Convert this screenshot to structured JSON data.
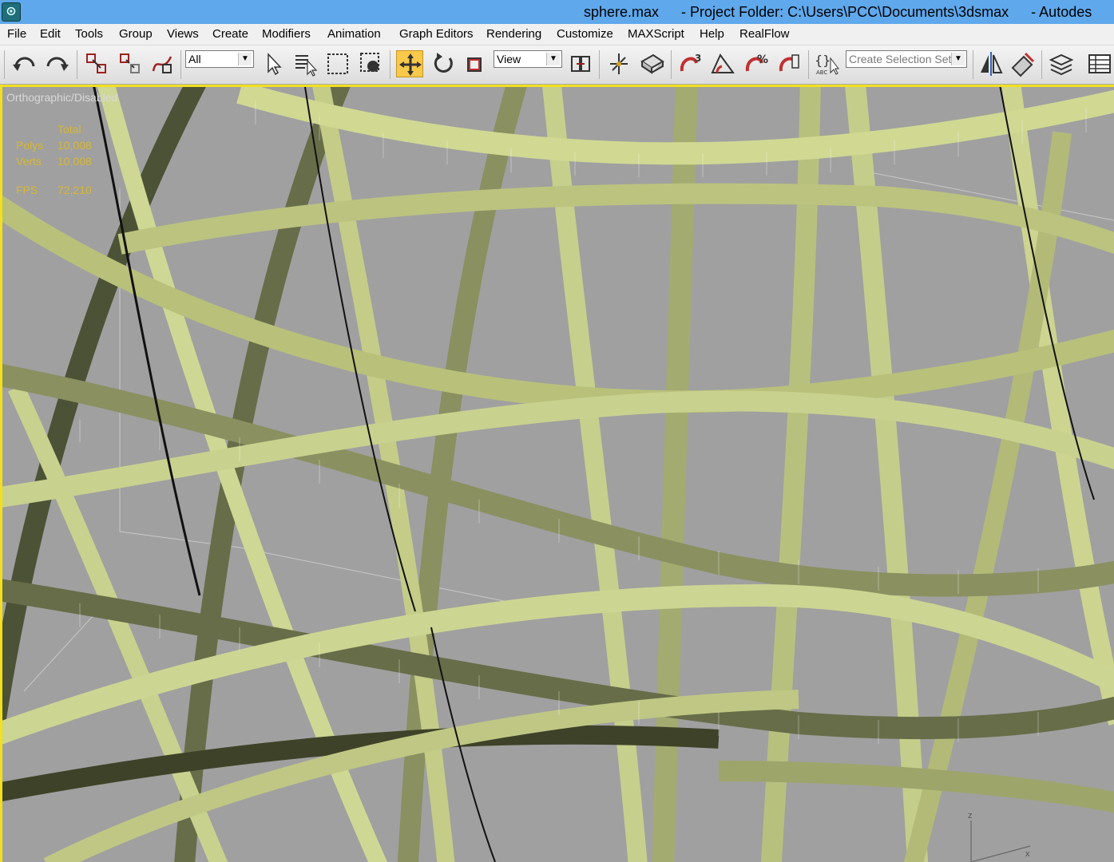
{
  "window": {
    "file_name": "sphere.max",
    "project_folder": "- Project Folder: C:\\Users\\PCC\\Documents\\3dsmax",
    "app_name": "- Autodes"
  },
  "menu": [
    "File",
    "Edit",
    "Tools",
    "Group",
    "Views",
    "Create",
    "Modifiers",
    "Animation",
    "Graph Editors",
    "Rendering",
    "Customize",
    "MAXScript",
    "Help",
    "RealFlow"
  ],
  "toolbar": {
    "selection_filter": "All",
    "reference_coord": "View",
    "selection_set_placeholder": "Create Selection Set",
    "active_tool": "select-and-move"
  },
  "viewport": {
    "label": "Orthographic/Disabled",
    "stats": {
      "header": "Total",
      "polys_label": "Polys",
      "polys_value": "10,008",
      "verts_label": "Verts",
      "verts_value": "10,008",
      "fps_label": "FPS",
      "fps_value": "72,210"
    },
    "axis_z": "z",
    "axis_x": "x",
    "border_color": "#f0e020",
    "background_color": "#a0a0a0"
  },
  "colors": {
    "titlebar": "#5fa8ec",
    "band_light": "#d4dc96",
    "band_dark": "#5a6040",
    "stats_text": "#d6b832"
  }
}
